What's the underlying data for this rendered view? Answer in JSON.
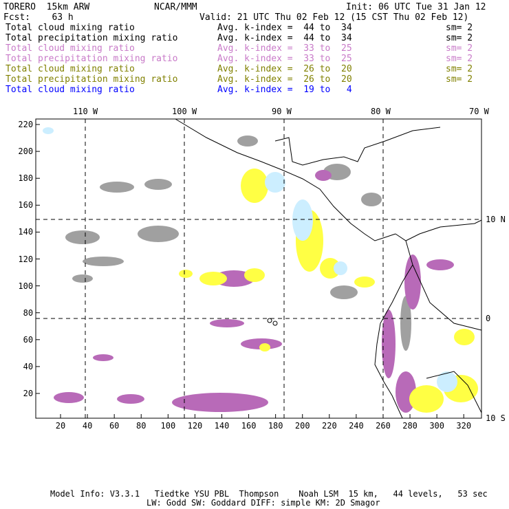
{
  "header": {
    "model": "TORERO  15km ARW",
    "org": "NCAR/MMM",
    "init": "Init: 06 UTC Tue 31 Jan 12",
    "fcst": "Fcst:    63 h",
    "valid": "Valid: 21 UTC Thu 02 Feb 12 (15 CST Thu 02 Feb 12)"
  },
  "legend": [
    {
      "field": "Total cloud mixing ratio",
      "kindex": "Avg. k-index =  44 to  34",
      "sm": "sm= 2",
      "color": "#000000"
    },
    {
      "field": "Total precipitation mixing ratio",
      "kindex": "Avg. k-index =  44 to  34",
      "sm": "sm= 2",
      "color": "#000000"
    },
    {
      "field": "Total cloud mixing ratio",
      "kindex": "Avg. k-index =  33 to  25",
      "sm": "sm= 2",
      "color": "#c87ac8"
    },
    {
      "field": "Total precipitation mixing ratio",
      "kindex": "Avg. k-index =  33 to  25",
      "sm": "sm= 2",
      "color": "#c87ac8"
    },
    {
      "field": "Total cloud mixing ratio",
      "kindex": "Avg. k-index =  26 to  20",
      "sm": "sm= 2",
      "color": "#808000"
    },
    {
      "field": "Total precipitation mixing ratio",
      "kindex": "Avg. k-index =  26 to  20",
      "sm": "sm= 2",
      "color": "#808000"
    },
    {
      "field": "Total cloud mixing ratio",
      "kindex": "Avg. k-index =  19 to   4",
      "sm": "",
      "color": "#0000ff"
    }
  ],
  "map": {
    "x_ticks": [
      "20",
      "40",
      "60",
      "80",
      "100",
      "120",
      "140",
      "160",
      "180",
      "200",
      "220",
      "240",
      "260",
      "280",
      "300",
      "320"
    ],
    "y_ticks": [
      "20",
      "40",
      "60",
      "80",
      "100",
      "120",
      "140",
      "160",
      "180",
      "200",
      "220"
    ],
    "lon_labels": [
      "110 W",
      "100 W",
      "90 W",
      "80 W",
      "70 W"
    ],
    "lat_labels": [
      "10 N",
      "0",
      "10 S"
    ]
  },
  "footer": {
    "line1": "Model Info: V3.3.1   Tiedtke YSU PBL  Thompson    Noah LSM  15 km,   44 levels,   53 sec",
    "line2": "LW: Godd SW: Goddard DIFF: simple KM: 2D Smagor"
  }
}
